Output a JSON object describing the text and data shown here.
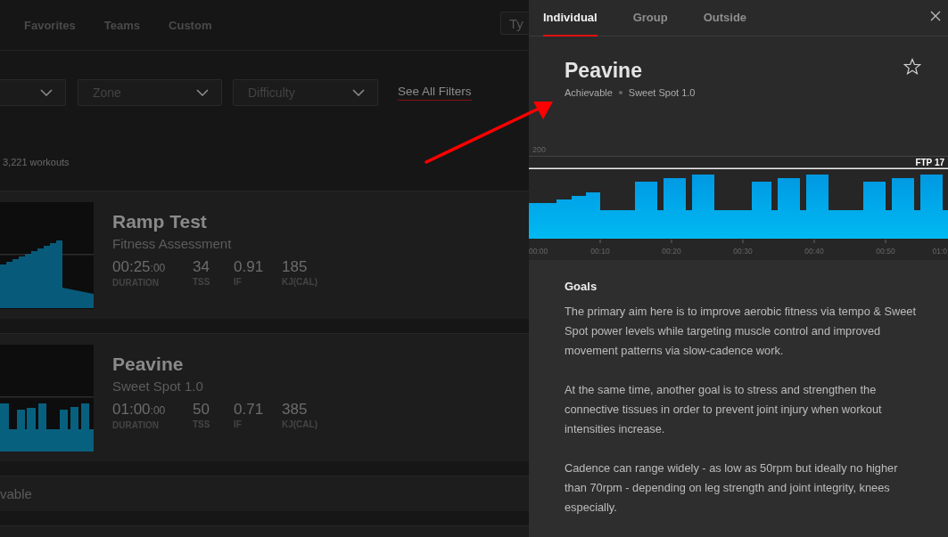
{
  "nav": {
    "tabs": [
      {
        "label": "Favorites",
        "selected": false
      },
      {
        "label": "Teams",
        "selected": false
      },
      {
        "label": "Custom",
        "selected": false
      }
    ],
    "search": {
      "placeholder": "Ty"
    }
  },
  "filters": {
    "dropdowns": [
      {
        "placeholder": "Zone"
      },
      {
        "placeholder": "Difficulty"
      }
    ],
    "link": "See All Filters"
  },
  "result_count": "3,221 workouts",
  "workouts": [
    {
      "kind": "ramp",
      "title": "Ramp Test",
      "category": "Fitness Assessment",
      "stats": [
        {
          "value": "00:25",
          "small": ":00",
          "label": "DURATION"
        },
        {
          "value": "34",
          "label": "TSS"
        },
        {
          "value": "0.91",
          "label": "IF"
        },
        {
          "value": "185",
          "label": "KJ(CAL)"
        }
      ]
    },
    {
      "kind": "intervals",
      "title": "Peavine",
      "category": "Sweet Spot 1.0",
      "stats": [
        {
          "value": "01:00",
          "small": ":00",
          "label": "DURATION"
        },
        {
          "value": "50",
          "label": "TSS"
        },
        {
          "value": "0.71",
          "label": "IF"
        },
        {
          "value": "385",
          "label": "KJ(CAL)"
        }
      ]
    }
  ],
  "partial_row": "vable",
  "detail": {
    "tabs": [
      {
        "label": "Individual",
        "selected": true
      },
      {
        "label": "Group",
        "selected": false
      },
      {
        "label": "Outside",
        "selected": false
      }
    ],
    "title": "Peavine",
    "tags": [
      "Achievable",
      "Sweet Spot 1.0"
    ],
    "favorite": false,
    "chart": {
      "y_label": "200",
      "ftp_label": "FTP 17",
      "x_ticks": [
        "00:00",
        "00:10",
        "00:20",
        "00:30",
        "00:40",
        "00:50",
        "01:0"
      ]
    },
    "sections": [
      {
        "heading": "Goals",
        "paragraphs": [
          "The primary aim here is to improve aerobic fitness via tempo & Sweet Spot power levels while targeting muscle control and improved movement patterns via slow-cadence work.",
          "At the same time, another goal is to stress and strengthen the connective tissues in order to prevent joint injury when workout intensities increase.",
          "Cadence can range widely - as low as 50rpm but ideally no higher than 70rpm - depending on leg strength and joint integrity, knees especially."
        ]
      }
    ]
  }
}
